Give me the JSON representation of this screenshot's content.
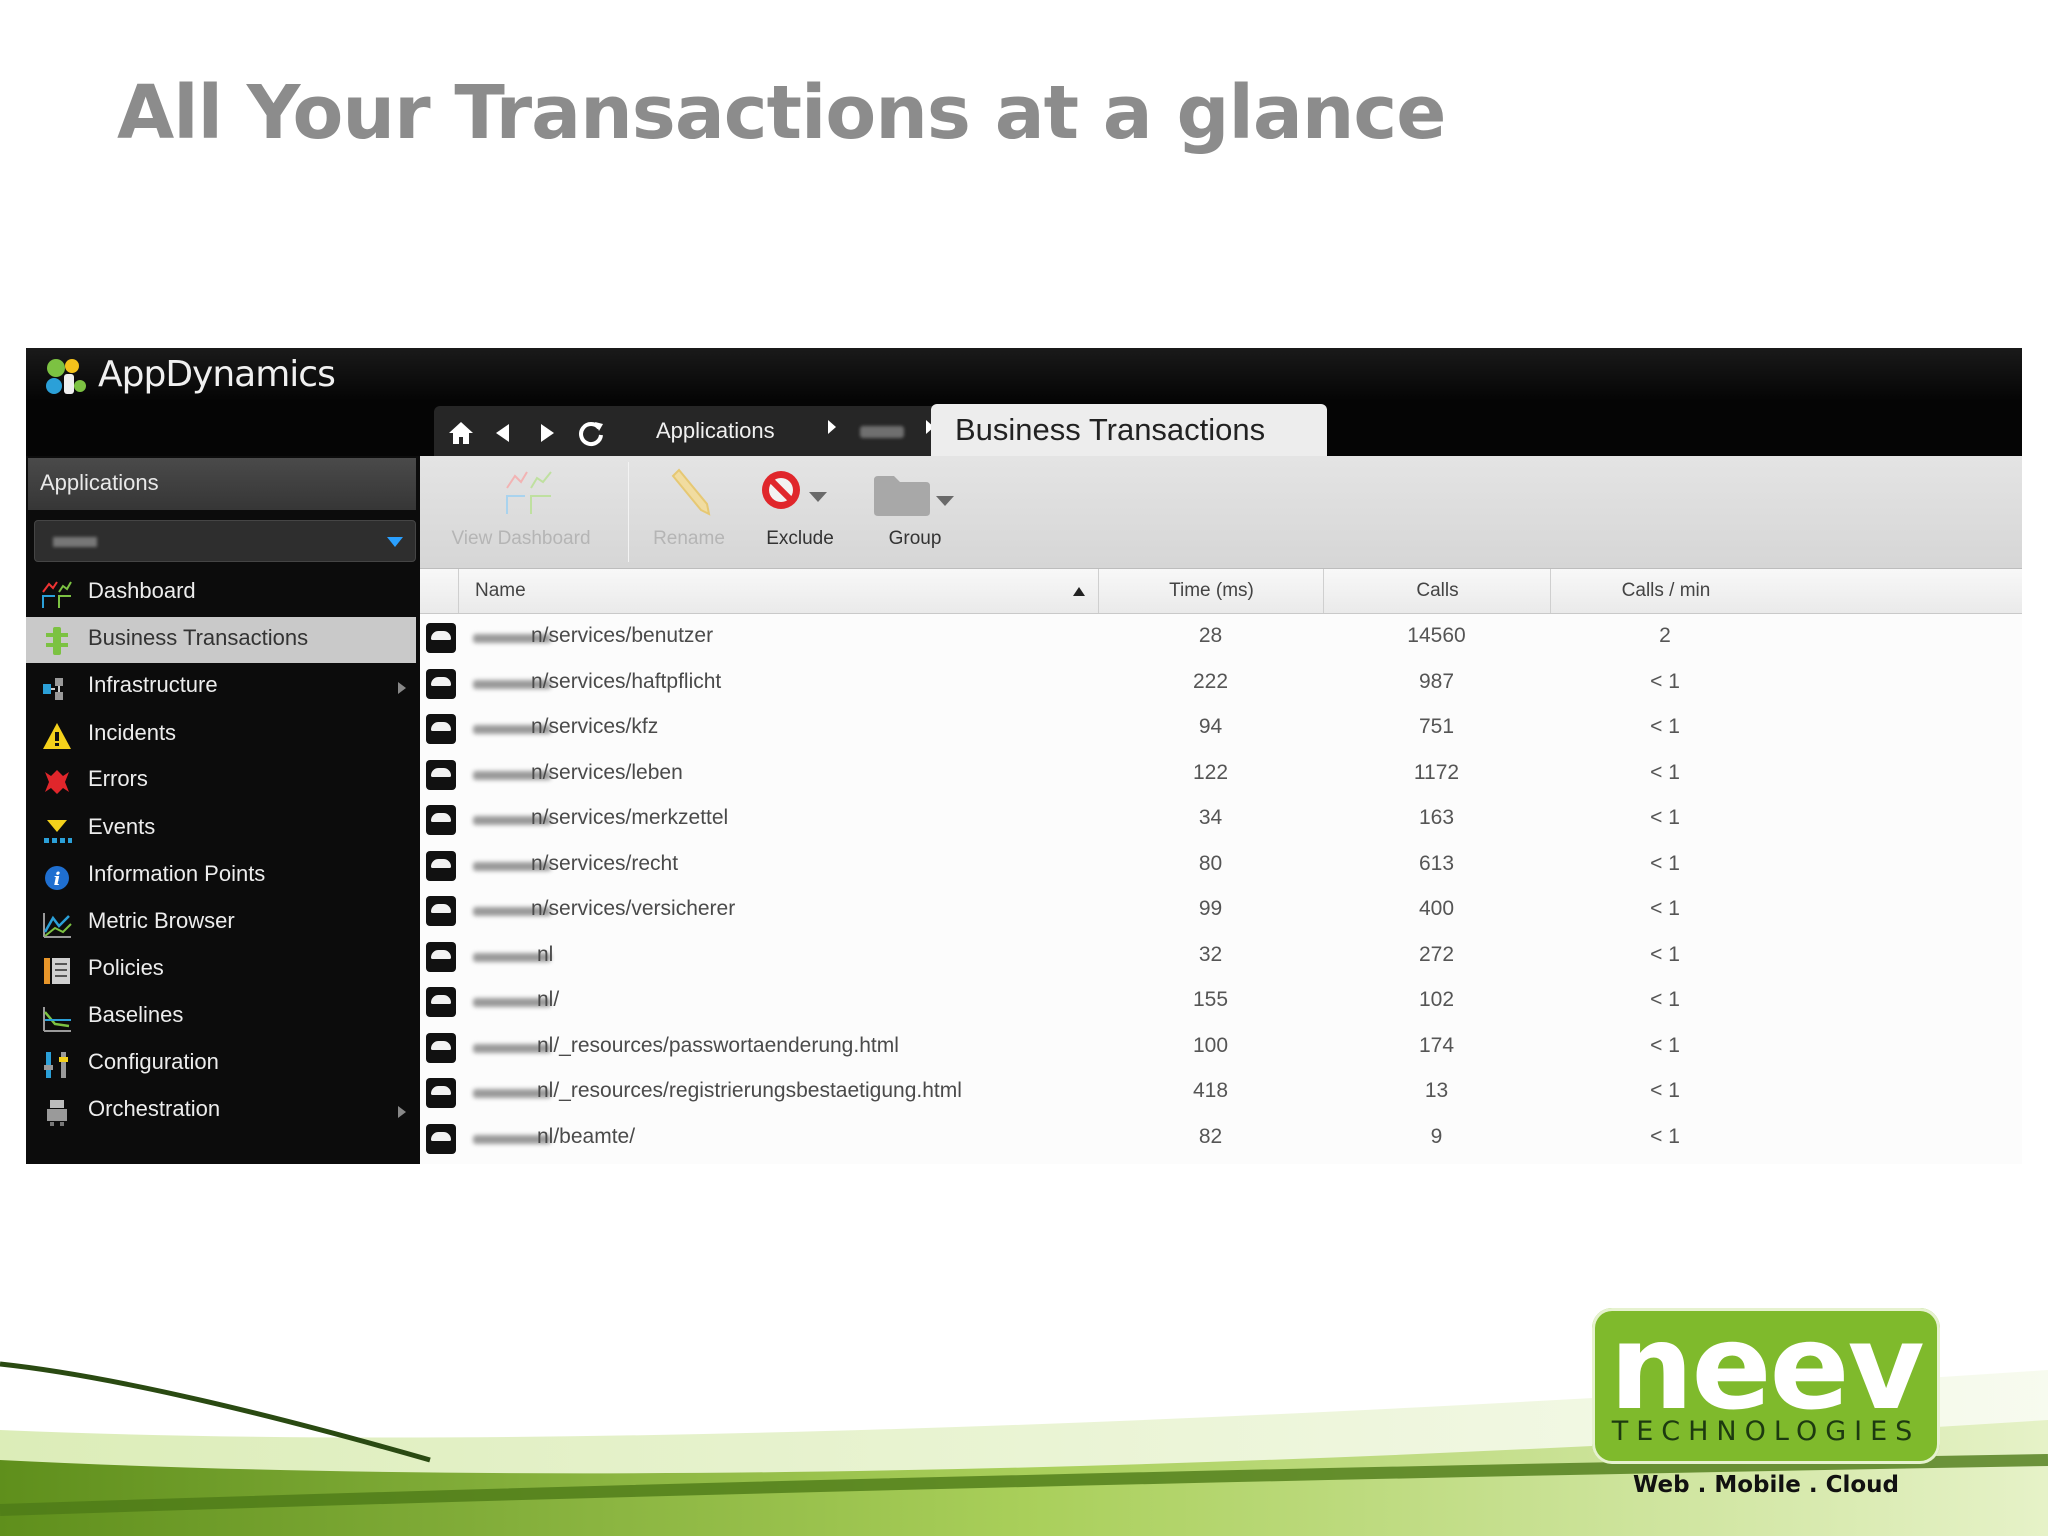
{
  "slide": {
    "title": "All Your Transactions at a glance"
  },
  "app": {
    "name": "AppDynamics"
  },
  "breadcrumb": {
    "applications": "Applications",
    "current_tab": "Business Transactions"
  },
  "sidebar": {
    "header": "Applications",
    "items": [
      {
        "label": "Dashboard",
        "icon": "dashboard-icon",
        "has_submenu": false,
        "selected": false
      },
      {
        "label": "Business Transactions",
        "icon": "business-transactions-icon",
        "has_submenu": false,
        "selected": true
      },
      {
        "label": "Infrastructure",
        "icon": "infrastructure-icon",
        "has_submenu": true,
        "selected": false
      },
      {
        "label": "Incidents",
        "icon": "warning-triangle-icon",
        "has_submenu": false,
        "selected": false
      },
      {
        "label": "Errors",
        "icon": "error-icon",
        "has_submenu": false,
        "selected": false
      },
      {
        "label": "Events",
        "icon": "events-icon",
        "has_submenu": false,
        "selected": false
      },
      {
        "label": "Information Points",
        "icon": "info-icon",
        "has_submenu": false,
        "selected": false
      },
      {
        "label": "Metric Browser",
        "icon": "metric-browser-icon",
        "has_submenu": false,
        "selected": false
      },
      {
        "label": "Policies",
        "icon": "policies-icon",
        "has_submenu": false,
        "selected": false
      },
      {
        "label": "Baselines",
        "icon": "baselines-icon",
        "has_submenu": false,
        "selected": false
      },
      {
        "label": "Configuration",
        "icon": "configuration-icon",
        "has_submenu": false,
        "selected": false
      },
      {
        "label": "Orchestration",
        "icon": "orchestration-icon",
        "has_submenu": true,
        "selected": false
      }
    ]
  },
  "toolbar": {
    "view_dashboard": "View Dashboard",
    "rename": "Rename",
    "exclude": "Exclude",
    "group": "Group"
  },
  "table": {
    "columns": [
      "Name",
      "Time (ms)",
      "Calls",
      "Calls / min"
    ],
    "sort": {
      "column": "Name",
      "direction": "ascending"
    },
    "rows": [
      {
        "name": "n/services/benutzer",
        "time": "28",
        "calls": "14560",
        "cpm": "2"
      },
      {
        "name": "n/services/haftpflicht",
        "time": "222",
        "calls": "987",
        "cpm": "< 1"
      },
      {
        "name": "n/services/kfz",
        "time": "94",
        "calls": "751",
        "cpm": "< 1"
      },
      {
        "name": "n/services/leben",
        "time": "122",
        "calls": "1172",
        "cpm": "< 1"
      },
      {
        "name": "n/services/merkzettel",
        "time": "34",
        "calls": "163",
        "cpm": "< 1"
      },
      {
        "name": "n/services/recht",
        "time": "80",
        "calls": "613",
        "cpm": "< 1"
      },
      {
        "name": "n/services/versicherer",
        "time": "99",
        "calls": "400",
        "cpm": "< 1"
      },
      {
        "name": "nl",
        "time": "32",
        "calls": "272",
        "cpm": "< 1"
      },
      {
        "name": "nl/",
        "time": "155",
        "calls": "102",
        "cpm": "< 1"
      },
      {
        "name": "nl/_resources/passwortaenderung.html",
        "time": "100",
        "calls": "174",
        "cpm": "< 1"
      },
      {
        "name": "nl/_resources/registrierungsbestaetigung.html",
        "time": "418",
        "calls": "13",
        "cpm": "< 1"
      },
      {
        "name": "nl/beamte/",
        "time": "82",
        "calls": "9",
        "cpm": "< 1"
      }
    ]
  },
  "brand": {
    "word": "neev",
    "sub": "TECHNOLOGIES",
    "tagline": "Web . Mobile . Cloud"
  },
  "colors": {
    "accent_green": "#7fba2c",
    "sidebar_bg": "#0c0c0c",
    "title_gray": "#8c8c8c"
  }
}
